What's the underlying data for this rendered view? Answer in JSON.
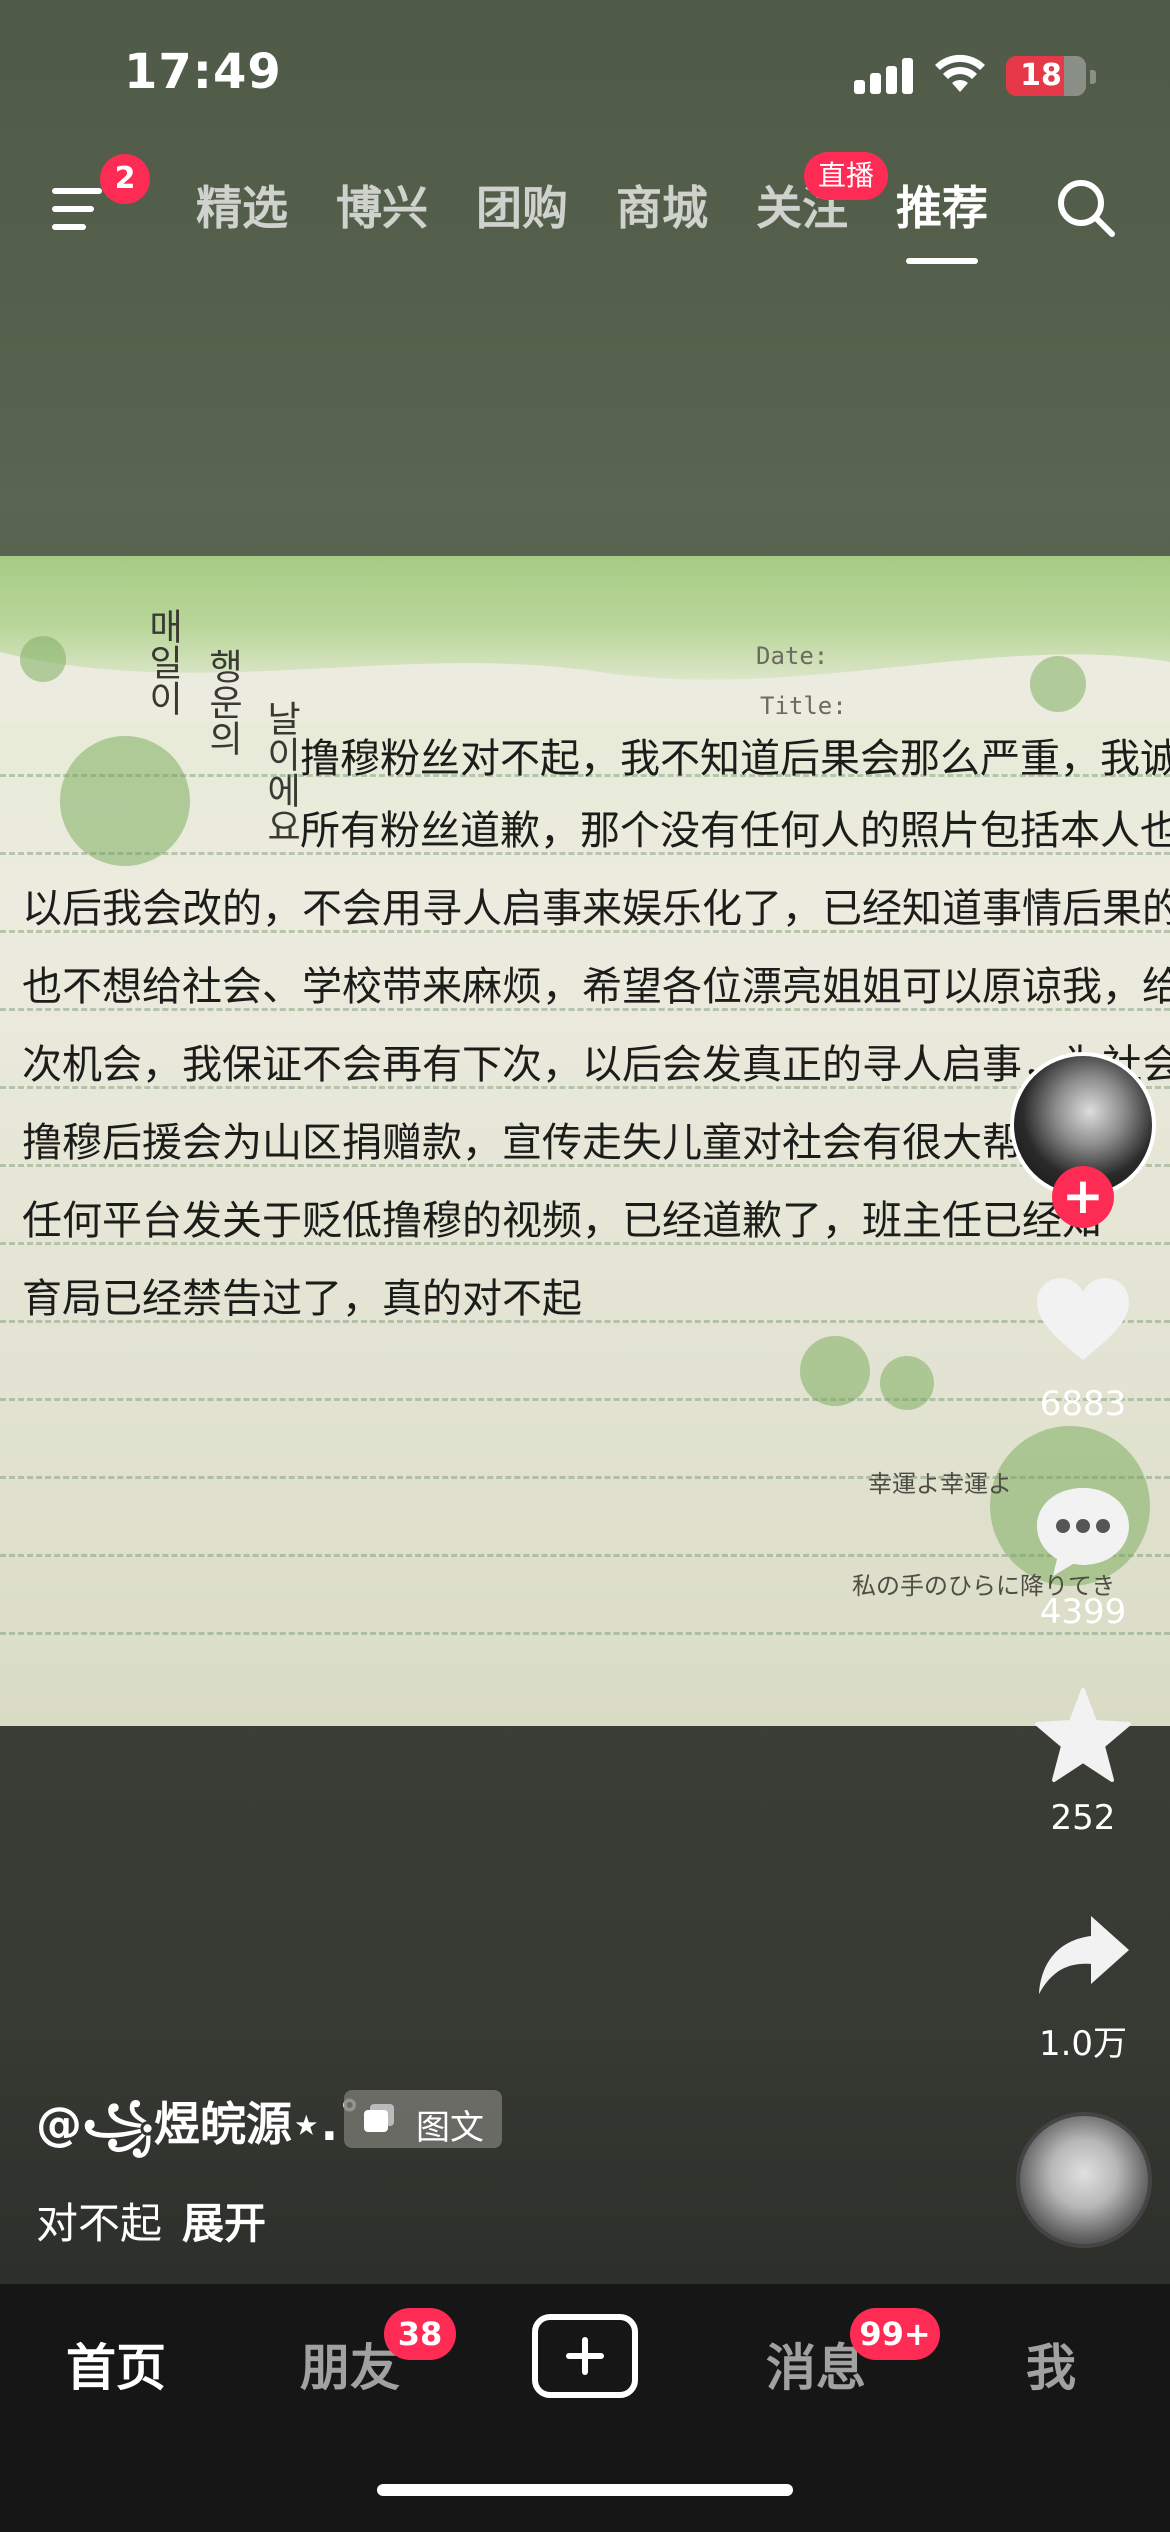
{
  "status_bar": {
    "time": "17:49",
    "battery": "18"
  },
  "top_nav": {
    "menu_badge": "2",
    "tabs": [
      {
        "label": "精选"
      },
      {
        "label": "博兴"
      },
      {
        "label": "团购"
      },
      {
        "label": "商城"
      },
      {
        "label": "关注"
      },
      {
        "label": "推荐"
      }
    ],
    "live_badge": "直播",
    "active_tab": "推荐"
  },
  "photo": {
    "korean_col1": "매일이",
    "korean_col2": "행운의",
    "korean_col3": "날이에요",
    "date_label": "Date:",
    "title_label": "Title:",
    "handwritten_lines": [
      "          撸穆粉丝对不起，我不知道后果会那么严重，我诚心向",
      "          所有粉丝道歉，那个没有任何人的照片包括本人也没有",
      "以后我会改的，不会用寻人启事来娱乐化了，已经知道事情后果的严重性",
      "也不想给社会、学校带来麻烦，希望各位漂亮姐姐可以原谅我，给我一",
      "次机会，我保证不会再有下次，以后会发真正的寻人启事，为社会做贡献",
      "撸穆后援会为山区捐赠款，宣传走失儿童对社会有很大帮助，",
      "任何平台发关于贬低撸穆的视频，已经道歉了，班主任已经知",
      "育局已经禁告过了，真的对不起"
    ],
    "japanese_1": "幸運よ幸運よ",
    "japanese_2": "私の手のひらに降りてき"
  },
  "actions": {
    "likes": "6883",
    "comments": "4399",
    "favorites": "252",
    "shares": "1.0万"
  },
  "caption": {
    "author": "@꧁煜皖源⋆.˚",
    "type_tag": "图文",
    "text": "对不起",
    "expand": "展开"
  },
  "bottom_bar": {
    "home": "首页",
    "friends": "朋友",
    "friends_badge": "38",
    "messages": "消息",
    "messages_badge": "99+",
    "me": "我"
  }
}
